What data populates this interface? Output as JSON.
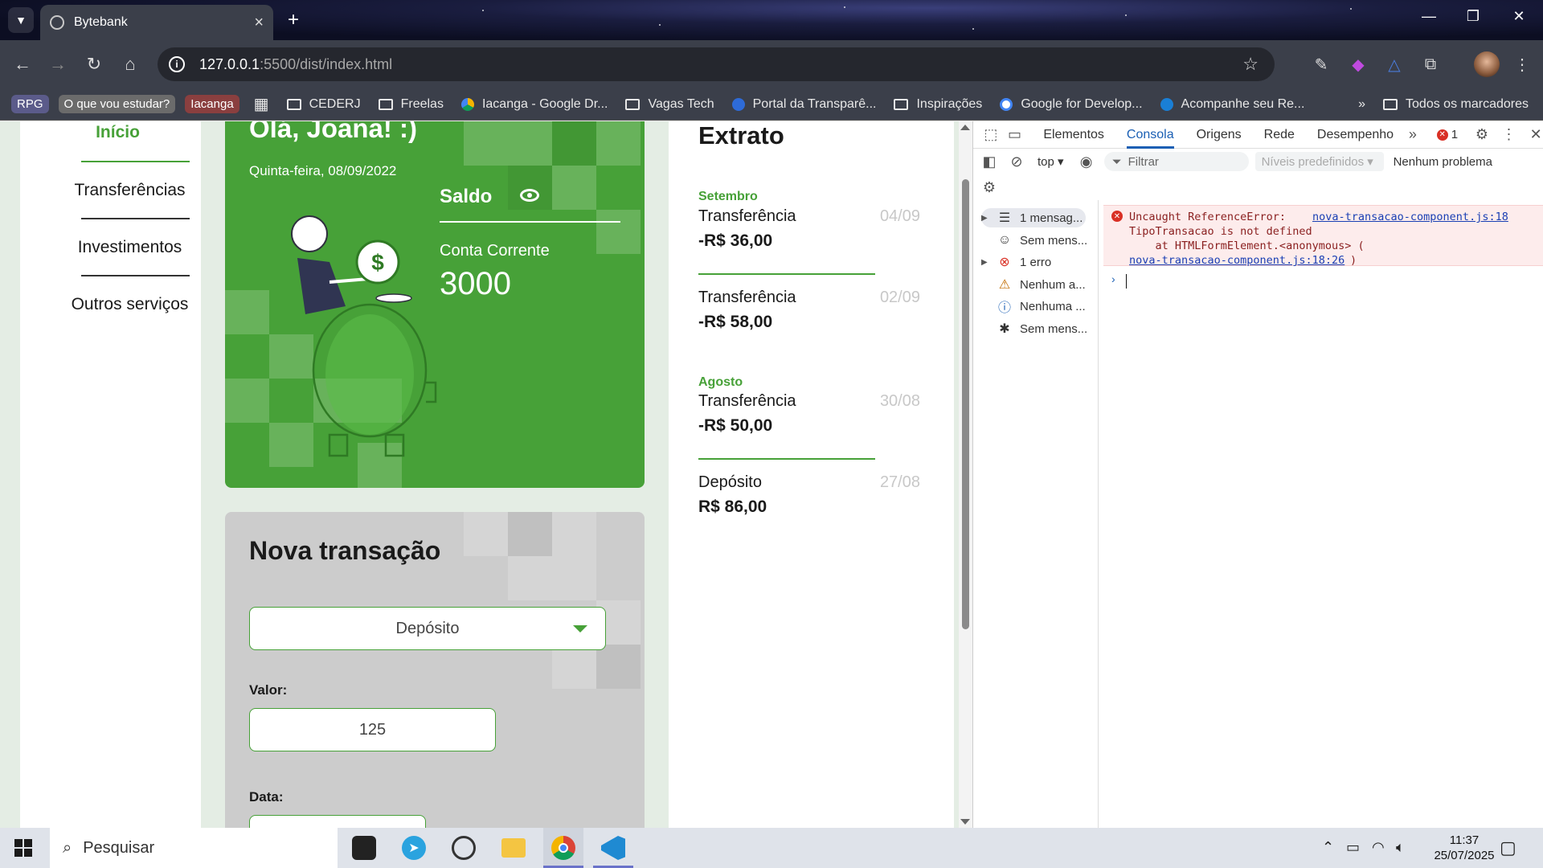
{
  "browser": {
    "tab_title": "Bytebank",
    "url_host": "127.0.0.1",
    "url_path": ":5500/dist/index.html",
    "bookmarks": [
      {
        "label": "RPG",
        "kind": "chip",
        "color": "#5b5b8a"
      },
      {
        "label": "O que vou estudar?",
        "kind": "chip",
        "color": "#6b6b6b"
      },
      {
        "label": "Iacanga",
        "kind": "chip",
        "color": "#8a3f3f"
      },
      {
        "label": "CEDERJ",
        "kind": "folder"
      },
      {
        "label": "Freelas",
        "kind": "folder"
      },
      {
        "label": "Iacanga - Google Dr...",
        "kind": "drive"
      },
      {
        "label": "Vagas Tech",
        "kind": "folder"
      },
      {
        "label": "Portal da Transparê...",
        "kind": "site"
      },
      {
        "label": "Inspirações",
        "kind": "folder"
      },
      {
        "label": "Google for Develop...",
        "kind": "google"
      },
      {
        "label": "Acompanhe seu Re...",
        "kind": "site"
      }
    ],
    "all_bookmarks": "Todos os marcadores"
  },
  "app": {
    "nav": [
      "Início",
      "Transferências",
      "Investimentos",
      "Outros serviços"
    ],
    "greeting": "Olá, Joana! :)",
    "date": "Quinta-feira, 08/09/2022",
    "saldo_label": "Saldo",
    "account_label": "Conta Corrente",
    "balance": "3000",
    "extrato_title": "Extrato",
    "extrato": [
      {
        "month": "Setembro",
        "type": "Transferência",
        "value": "-R$ 36,00",
        "date": "04/09"
      },
      {
        "month": "",
        "type": "Transferência",
        "value": "-R$ 58,00",
        "date": "02/09"
      },
      {
        "month": "Agosto",
        "type": "Transferência",
        "value": "-R$ 50,00",
        "date": "30/08"
      },
      {
        "month": "",
        "type": "Depósito",
        "value": "R$ 86,00",
        "date": "27/08"
      }
    ],
    "nova_title": "Nova transação",
    "select_value": "Depósito",
    "valor_label": "Valor:",
    "valor_value": "125",
    "data_label": "Data:"
  },
  "devtools": {
    "tabs": [
      "Elementos",
      "Consola",
      "Origens",
      "Rede",
      "Desempenho"
    ],
    "active_tab": "Consola",
    "error_count": "1",
    "context": "top",
    "filter_placeholder": "Filtrar",
    "levels": "Níveis predefinidos",
    "issues": "Nenhum problema",
    "sidebar": [
      {
        "label": "1 mensag...",
        "icon": "list-icon"
      },
      {
        "label": "Sem mens...",
        "icon": "user-icon"
      },
      {
        "label": "1 erro",
        "icon": "error-icon"
      },
      {
        "label": "Nenhum a...",
        "icon": "warning-icon"
      },
      {
        "label": "Nenhuma ...",
        "icon": "info-icon"
      },
      {
        "label": "Sem mens...",
        "icon": "bug-icon"
      }
    ],
    "error": {
      "line1": "Uncaught ReferenceError:",
      "link1": "nova-transacao-component.js:18",
      "line2": "TipoTransacao is not defined",
      "line3": "    at HTMLFormElement.<anonymous> (",
      "link2": "nova-transacao-component.js:18:26",
      "close": ")"
    }
  },
  "taskbar": {
    "search": "Pesquisar",
    "time": "11:37",
    "date": "25/07/2025"
  },
  "colors": {
    "brand_green": "#47a138",
    "devtools_blue": "#1a5fb4",
    "error_red": "#d93025"
  }
}
